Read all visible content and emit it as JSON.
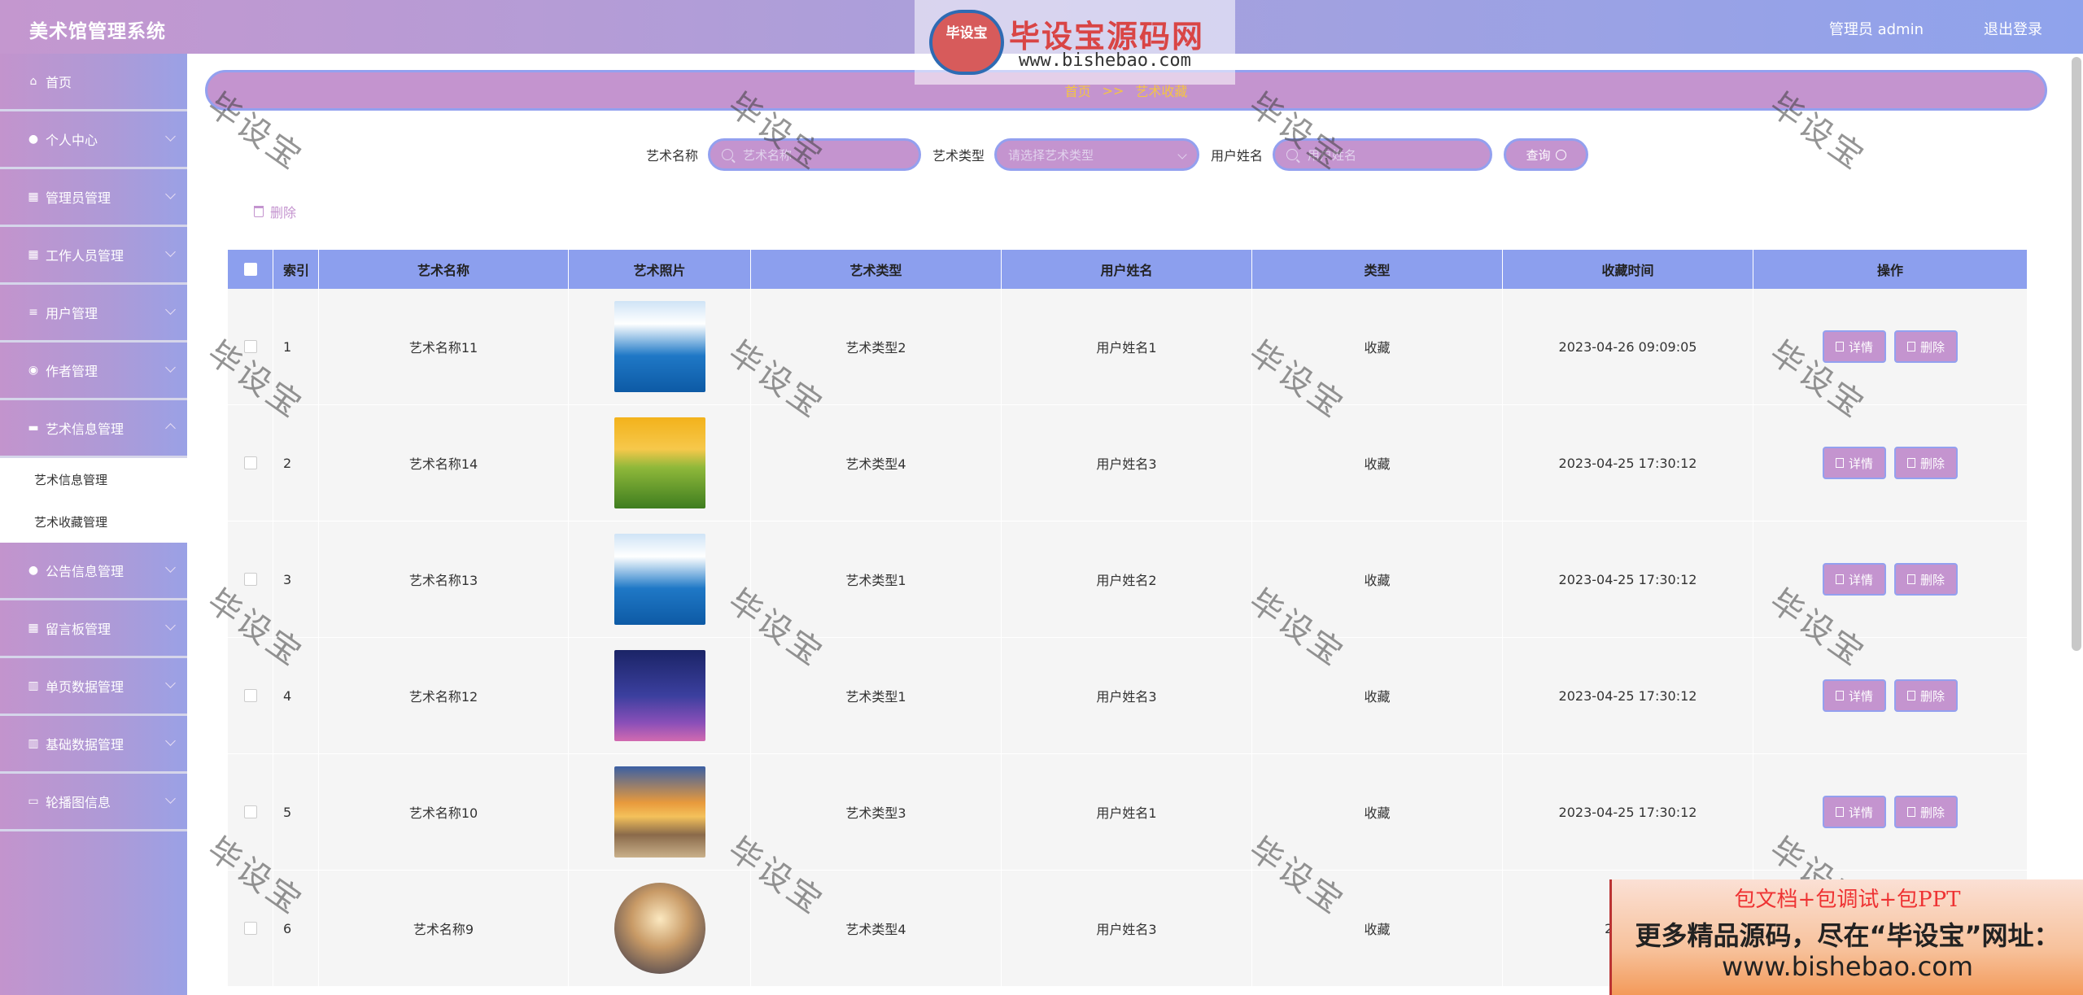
{
  "header": {
    "app_title": "美术馆管理系统",
    "admin_label": "管理员 admin",
    "logout_label": "退出登录"
  },
  "sidebar": {
    "items": [
      {
        "label": "首页",
        "icon": "home-icon"
      },
      {
        "label": "个人中心",
        "icon": "user-icon"
      },
      {
        "label": "管理员管理",
        "icon": "grid-icon"
      },
      {
        "label": "工作人员管理",
        "icon": "grid-icon"
      },
      {
        "label": "用户管理",
        "icon": "list-icon"
      },
      {
        "label": "作者管理",
        "icon": "location-icon"
      },
      {
        "label": "艺术信息管理",
        "icon": "monitor-icon"
      }
    ],
    "submenu": [
      "艺术信息管理",
      "艺术收藏管理"
    ],
    "items_after": [
      {
        "label": "公告信息管理",
        "icon": "user-icon"
      },
      {
        "label": "留言板管理",
        "icon": "grid-icon"
      },
      {
        "label": "单页数据管理",
        "icon": "chart-icon"
      },
      {
        "label": "基础数据管理",
        "icon": "chart-icon"
      },
      {
        "label": "轮播图信息",
        "icon": "ticket-icon"
      }
    ]
  },
  "breadcrumb": {
    "home": "首页",
    "separator": ">>",
    "current": "艺术收藏"
  },
  "search": {
    "art_name_label": "艺术名称",
    "art_name_placeholder": "艺术名称",
    "art_type_label": "艺术类型",
    "art_type_placeholder": "请选择艺术类型",
    "user_name_label": "用户姓名",
    "user_name_placeholder": "用户姓名",
    "query_label": "查询"
  },
  "bulk_delete_label": "删除",
  "table": {
    "headers": [
      "索引",
      "艺术名称",
      "艺术照片",
      "艺术类型",
      "用户姓名",
      "类型",
      "收藏时间",
      "操作"
    ],
    "detail_label": "详情",
    "delete_label": "删除",
    "rows": [
      {
        "index": "1",
        "name": "艺术名称11",
        "type": "艺术类型2",
        "user": "用户姓名1",
        "kind": "收藏",
        "time": "2023-04-26 09:09:05",
        "photo": "sea"
      },
      {
        "index": "2",
        "name": "艺术名称14",
        "type": "艺术类型4",
        "user": "用户姓名3",
        "kind": "收藏",
        "time": "2023-04-25 17:30:12",
        "photo": "flowers"
      },
      {
        "index": "3",
        "name": "艺术名称13",
        "type": "艺术类型1",
        "user": "用户姓名2",
        "kind": "收藏",
        "time": "2023-04-25 17:30:12",
        "photo": "sea"
      },
      {
        "index": "4",
        "name": "艺术名称12",
        "type": "艺术类型1",
        "user": "用户姓名3",
        "kind": "收藏",
        "time": "2023-04-25 17:30:12",
        "photo": "tower"
      },
      {
        "index": "5",
        "name": "艺术名称10",
        "type": "艺术类型3",
        "user": "用户姓名1",
        "kind": "收藏",
        "time": "2023-04-25 17:30:12",
        "photo": "sunset"
      },
      {
        "index": "6",
        "name": "艺术名称9",
        "type": "艺术类型4",
        "user": "用户姓名3",
        "kind": "收藏",
        "time": "2023-0",
        "photo": "desert"
      }
    ]
  },
  "watermark_text": "毕设宝",
  "logo": {
    "badge": "毕设宝",
    "title": "毕设宝源码网",
    "url": "www.bishebao.com"
  },
  "ad": {
    "line1": "包文档+包调试+包PPT",
    "line2": "更多精品源码，尽在“毕设宝”网址：",
    "line3": "www.bishebao.com"
  }
}
